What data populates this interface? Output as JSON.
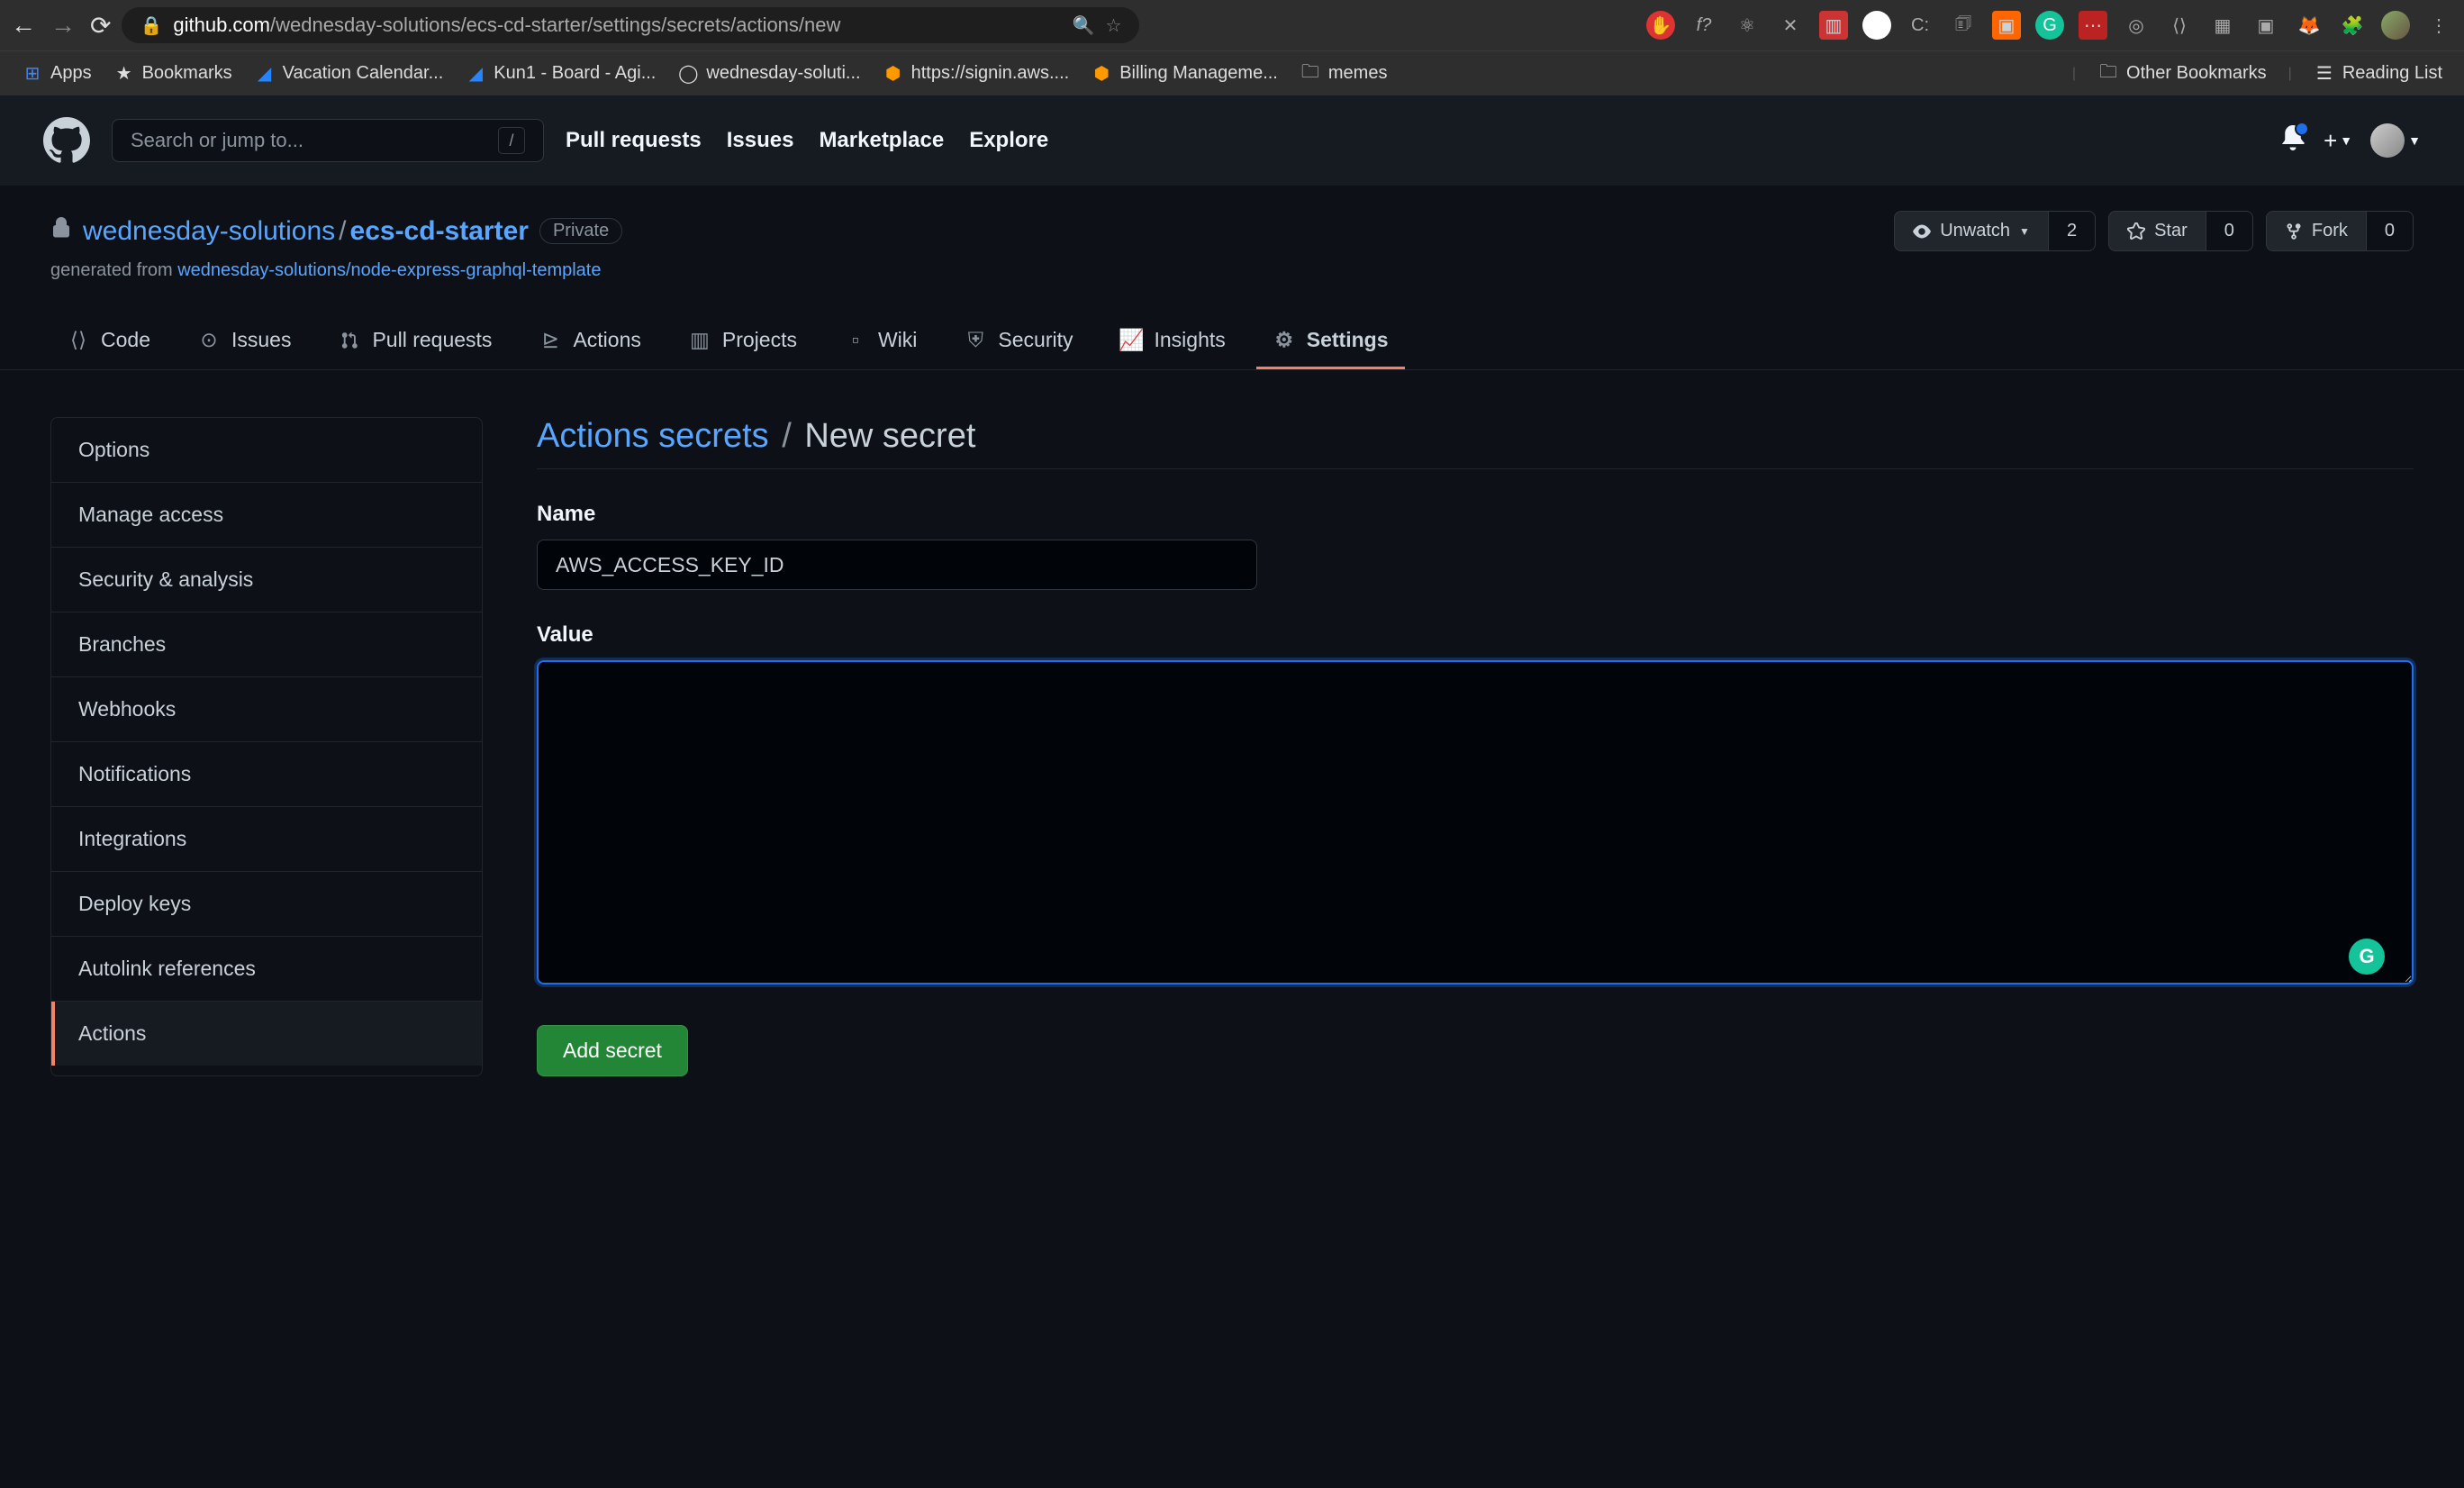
{
  "browser": {
    "url_prefix": "github.com",
    "url_path": "/wednesday-solutions/ecs-cd-starter/settings/secrets/actions/new",
    "bookmarks": [
      {
        "label": "Apps",
        "icon": "grid"
      },
      {
        "label": "Bookmarks",
        "icon": "star"
      },
      {
        "label": "Vacation Calendar...",
        "icon": "blue"
      },
      {
        "label": "Kun1 - Board - Agi...",
        "icon": "blue"
      },
      {
        "label": "wednesday-soluti...",
        "icon": "github"
      },
      {
        "label": "https://signin.aws....",
        "icon": "orange"
      },
      {
        "label": "Billing Manageme...",
        "icon": "orange"
      },
      {
        "label": "memes",
        "icon": "folder"
      }
    ],
    "bookmarks_right": [
      {
        "label": "Other Bookmarks",
        "icon": "folder"
      },
      {
        "label": "Reading List",
        "icon": "list"
      }
    ]
  },
  "gh_header": {
    "search_placeholder": "Search or jump to...",
    "nav": [
      "Pull requests",
      "Issues",
      "Marketplace",
      "Explore"
    ]
  },
  "repo": {
    "owner": "wednesday-solutions",
    "name": "ecs-cd-starter",
    "visibility": "Private",
    "generated_text": "generated from ",
    "template_link": "wednesday-solutions/node-express-graphql-template",
    "watch_label": "Unwatch",
    "watch_count": "2",
    "star_label": "Star",
    "star_count": "0",
    "fork_label": "Fork",
    "fork_count": "0",
    "tabs": [
      {
        "label": "Code",
        "icon": "code"
      },
      {
        "label": "Issues",
        "icon": "issue"
      },
      {
        "label": "Pull requests",
        "icon": "pr"
      },
      {
        "label": "Actions",
        "icon": "play"
      },
      {
        "label": "Projects",
        "icon": "project"
      },
      {
        "label": "Wiki",
        "icon": "book"
      },
      {
        "label": "Security",
        "icon": "shield"
      },
      {
        "label": "Insights",
        "icon": "graph"
      },
      {
        "label": "Settings",
        "icon": "gear"
      }
    ]
  },
  "sidebar": {
    "items": [
      "Options",
      "Manage access",
      "Security & analysis",
      "Branches",
      "Webhooks",
      "Notifications",
      "Integrations",
      "Deploy keys",
      "Autolink references",
      "Actions"
    ]
  },
  "main": {
    "breadcrumb": "Actions secrets",
    "title": "New secret",
    "name_label": "Name",
    "name_value": "AWS_ACCESS_KEY_ID",
    "value_label": "Value",
    "value_value": "",
    "submit_label": "Add secret"
  }
}
